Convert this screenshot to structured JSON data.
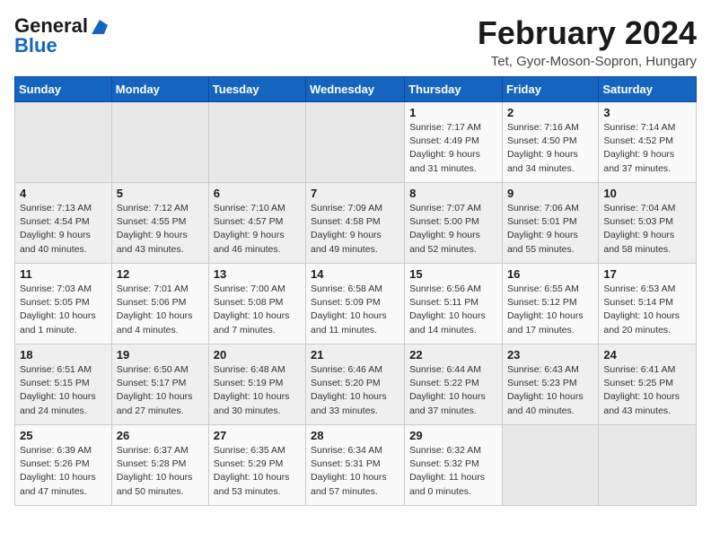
{
  "header": {
    "logo_line1": "General",
    "logo_line2": "Blue",
    "month": "February 2024",
    "location": "Tet, Gyor-Moson-Sopron, Hungary"
  },
  "weekdays": [
    "Sunday",
    "Monday",
    "Tuesday",
    "Wednesday",
    "Thursday",
    "Friday",
    "Saturday"
  ],
  "weeks": [
    [
      {
        "day": "",
        "info": ""
      },
      {
        "day": "",
        "info": ""
      },
      {
        "day": "",
        "info": ""
      },
      {
        "day": "",
        "info": ""
      },
      {
        "day": "1",
        "info": "Sunrise: 7:17 AM\nSunset: 4:49 PM\nDaylight: 9 hours\nand 31 minutes."
      },
      {
        "day": "2",
        "info": "Sunrise: 7:16 AM\nSunset: 4:50 PM\nDaylight: 9 hours\nand 34 minutes."
      },
      {
        "day": "3",
        "info": "Sunrise: 7:14 AM\nSunset: 4:52 PM\nDaylight: 9 hours\nand 37 minutes."
      }
    ],
    [
      {
        "day": "4",
        "info": "Sunrise: 7:13 AM\nSunset: 4:54 PM\nDaylight: 9 hours\nand 40 minutes."
      },
      {
        "day": "5",
        "info": "Sunrise: 7:12 AM\nSunset: 4:55 PM\nDaylight: 9 hours\nand 43 minutes."
      },
      {
        "day": "6",
        "info": "Sunrise: 7:10 AM\nSunset: 4:57 PM\nDaylight: 9 hours\nand 46 minutes."
      },
      {
        "day": "7",
        "info": "Sunrise: 7:09 AM\nSunset: 4:58 PM\nDaylight: 9 hours\nand 49 minutes."
      },
      {
        "day": "8",
        "info": "Sunrise: 7:07 AM\nSunset: 5:00 PM\nDaylight: 9 hours\nand 52 minutes."
      },
      {
        "day": "9",
        "info": "Sunrise: 7:06 AM\nSunset: 5:01 PM\nDaylight: 9 hours\nand 55 minutes."
      },
      {
        "day": "10",
        "info": "Sunrise: 7:04 AM\nSunset: 5:03 PM\nDaylight: 9 hours\nand 58 minutes."
      }
    ],
    [
      {
        "day": "11",
        "info": "Sunrise: 7:03 AM\nSunset: 5:05 PM\nDaylight: 10 hours\nand 1 minute."
      },
      {
        "day": "12",
        "info": "Sunrise: 7:01 AM\nSunset: 5:06 PM\nDaylight: 10 hours\nand 4 minutes."
      },
      {
        "day": "13",
        "info": "Sunrise: 7:00 AM\nSunset: 5:08 PM\nDaylight: 10 hours\nand 7 minutes."
      },
      {
        "day": "14",
        "info": "Sunrise: 6:58 AM\nSunset: 5:09 PM\nDaylight: 10 hours\nand 11 minutes."
      },
      {
        "day": "15",
        "info": "Sunrise: 6:56 AM\nSunset: 5:11 PM\nDaylight: 10 hours\nand 14 minutes."
      },
      {
        "day": "16",
        "info": "Sunrise: 6:55 AM\nSunset: 5:12 PM\nDaylight: 10 hours\nand 17 minutes."
      },
      {
        "day": "17",
        "info": "Sunrise: 6:53 AM\nSunset: 5:14 PM\nDaylight: 10 hours\nand 20 minutes."
      }
    ],
    [
      {
        "day": "18",
        "info": "Sunrise: 6:51 AM\nSunset: 5:15 PM\nDaylight: 10 hours\nand 24 minutes."
      },
      {
        "day": "19",
        "info": "Sunrise: 6:50 AM\nSunset: 5:17 PM\nDaylight: 10 hours\nand 27 minutes."
      },
      {
        "day": "20",
        "info": "Sunrise: 6:48 AM\nSunset: 5:19 PM\nDaylight: 10 hours\nand 30 minutes."
      },
      {
        "day": "21",
        "info": "Sunrise: 6:46 AM\nSunset: 5:20 PM\nDaylight: 10 hours\nand 33 minutes."
      },
      {
        "day": "22",
        "info": "Sunrise: 6:44 AM\nSunset: 5:22 PM\nDaylight: 10 hours\nand 37 minutes."
      },
      {
        "day": "23",
        "info": "Sunrise: 6:43 AM\nSunset: 5:23 PM\nDaylight: 10 hours\nand 40 minutes."
      },
      {
        "day": "24",
        "info": "Sunrise: 6:41 AM\nSunset: 5:25 PM\nDaylight: 10 hours\nand 43 minutes."
      }
    ],
    [
      {
        "day": "25",
        "info": "Sunrise: 6:39 AM\nSunset: 5:26 PM\nDaylight: 10 hours\nand 47 minutes."
      },
      {
        "day": "26",
        "info": "Sunrise: 6:37 AM\nSunset: 5:28 PM\nDaylight: 10 hours\nand 50 minutes."
      },
      {
        "day": "27",
        "info": "Sunrise: 6:35 AM\nSunset: 5:29 PM\nDaylight: 10 hours\nand 53 minutes."
      },
      {
        "day": "28",
        "info": "Sunrise: 6:34 AM\nSunset: 5:31 PM\nDaylight: 10 hours\nand 57 minutes."
      },
      {
        "day": "29",
        "info": "Sunrise: 6:32 AM\nSunset: 5:32 PM\nDaylight: 11 hours\nand 0 minutes."
      },
      {
        "day": "",
        "info": ""
      },
      {
        "day": "",
        "info": ""
      }
    ]
  ]
}
